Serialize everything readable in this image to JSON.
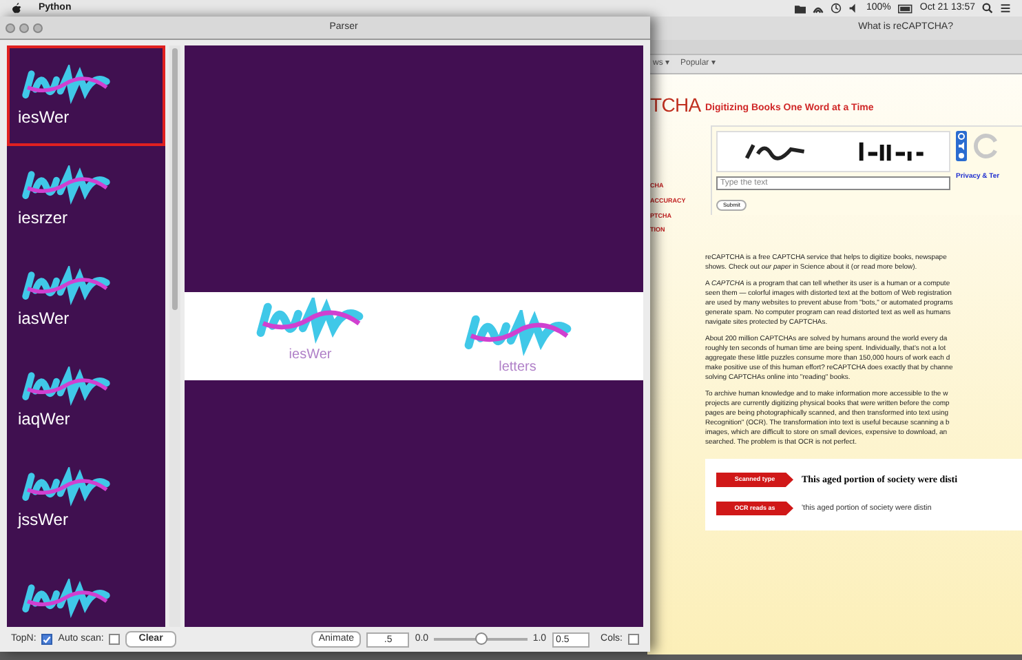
{
  "menu_bar": {
    "app": "Python",
    "battery": "100%",
    "clock": "Oct 21 13:57"
  },
  "parser_window": {
    "title": "Parser",
    "sidebar": [
      {
        "label": "iesWer",
        "selected": true
      },
      {
        "label": "iesrzer",
        "selected": false
      },
      {
        "label": "iasWer",
        "selected": false
      },
      {
        "label": "iaqWer",
        "selected": false
      },
      {
        "label": "jssWer",
        "selected": false
      },
      {
        "selected": false
      }
    ],
    "preview": [
      {
        "label": "iesWer"
      },
      {
        "label": "letters"
      }
    ],
    "toolbar": {
      "top_n": {
        "label": "TopN:",
        "checked": true
      },
      "auto_scan": {
        "label": "Auto scan:",
        "checked": false
      },
      "clear": "Clear",
      "animate": "Animate",
      "speed": ".5",
      "slider": {
        "min": "0.0",
        "max": "1.0",
        "level": 0.5
      },
      "value": "0.5",
      "cols": {
        "label": "Cols:",
        "checked": false
      }
    }
  },
  "browser": {
    "title": "What is reCAPTCHA?",
    "bookmarks": [
      "ws ▾",
      "Popular ▾"
    ],
    "logo": "TCHA",
    "nav": [
      "CHA",
      "ACCURACY",
      "PTCHA",
      "TION"
    ],
    "heading": "Digitizing Books One Word at a Time",
    "captcha": {
      "placeholder": "Type the text",
      "submit": "Submit",
      "privacy": "Privacy & Ter"
    },
    "paragraphs": [
      [
        "reCAPTCHA is a free CAPTCHA service that helps to digitize books, newspape",
        "shows. Check out *our paper* in Science about it (or read more below)."
      ],
      [
        "A *CAPTCHA* is a program that can tell whether its user is a human or a compute",
        "seen them — colorful images with distorted text at the bottom of Web registration",
        "are used by many websites to prevent abuse from \"bots,\" or automated programs",
        "generate spam. No computer program can read distorted text as well as humans",
        "navigate sites protected by CAPTCHAs."
      ],
      [
        "About 200 million CAPTCHAs are solved by humans around the world every da",
        "roughly ten seconds of human time are being spent. Individually, that's not a lot",
        "aggregate these little puzzles consume more than 150,000 hours of work each d",
        "make positive use of this human effort? reCAPTCHA does exactly that by channe",
        "solving CAPTCHAs online into \"reading\" books."
      ],
      [
        "To archive human knowledge and to make information more accessible to the w",
        "projects are currently digitizing physical books that were written before the comp",
        "pages are being photographically scanned, and then transformed into text using",
        "Recognition\" (OCR). The transformation into text is useful because scanning a b",
        "images, which are difficult to store on small devices, expensive to download, an",
        "searched. The problem is that OCR is not perfect."
      ]
    ],
    "figure": [
      {
        "tag": "Scanned type",
        "text": "This aged portion of society were disti",
        "kind": "scan"
      },
      {
        "tag": "OCR reads as",
        "text": "'this aged portion of society were distin",
        "kind": "ocr"
      }
    ]
  }
}
